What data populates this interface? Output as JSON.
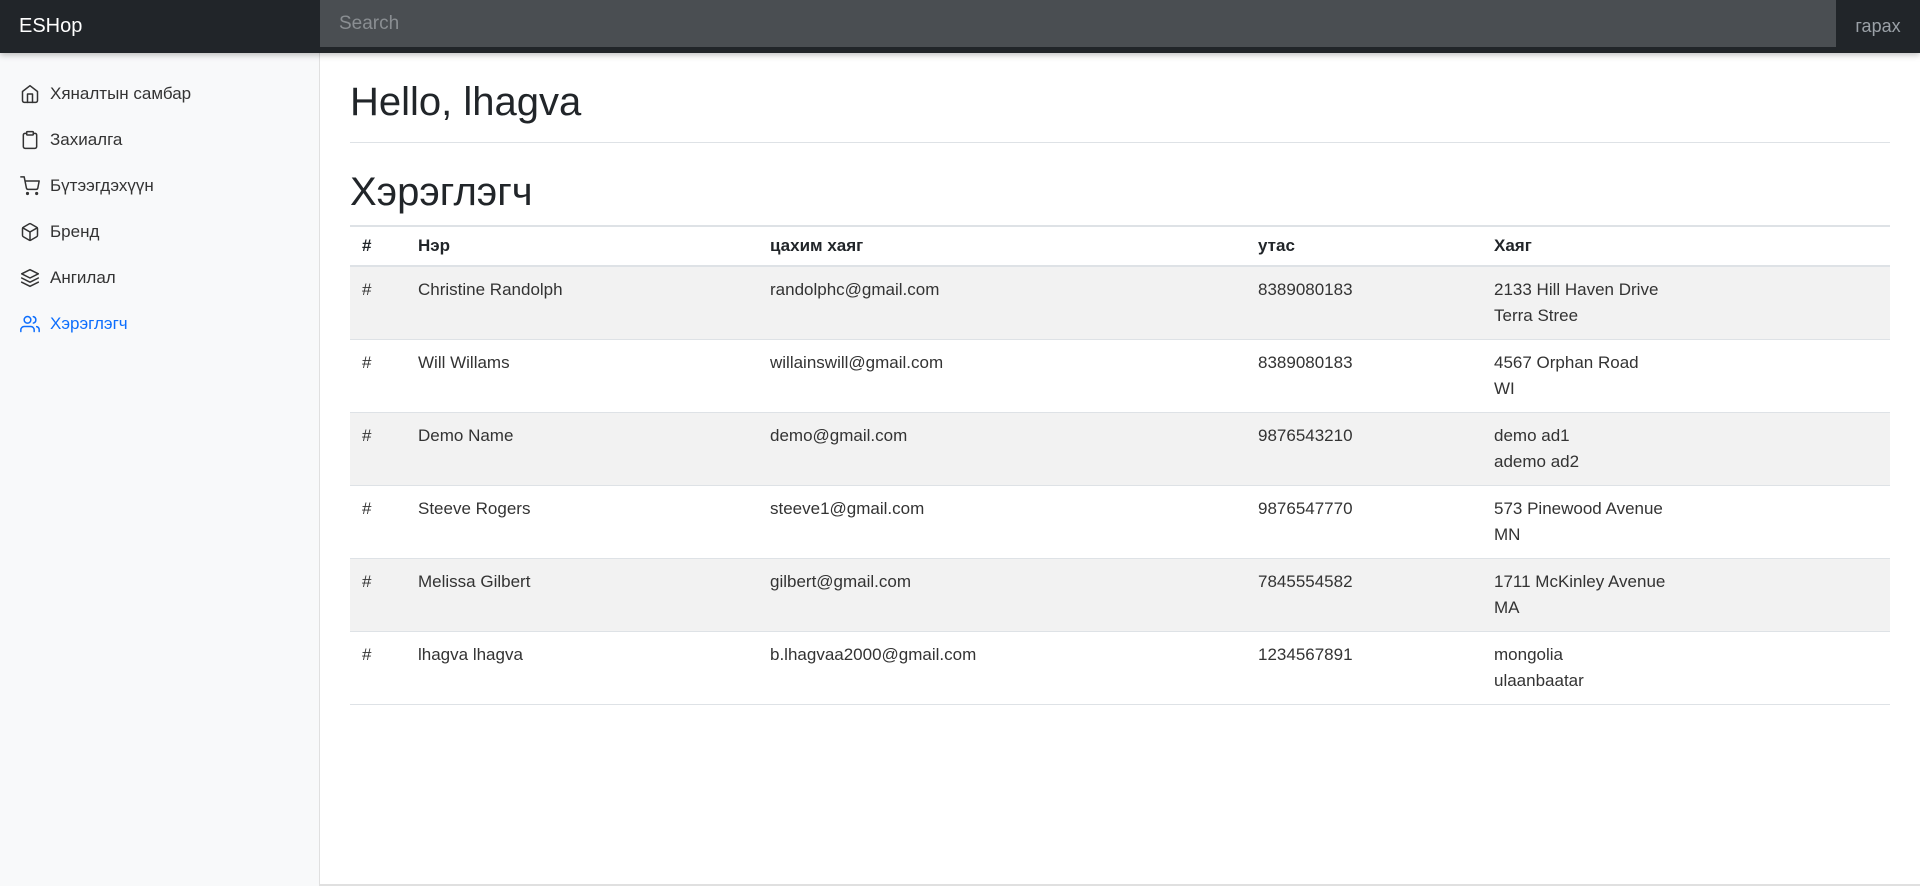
{
  "navbar": {
    "brand": "ESHop",
    "search_placeholder": "Search",
    "signout": "гарах"
  },
  "sidebar": {
    "items": [
      {
        "label": "Хяналтын самбар",
        "icon": "home-icon",
        "active": false
      },
      {
        "label": "Захиалга",
        "icon": "clipboard-icon",
        "active": false
      },
      {
        "label": "Бүтээгдэхүүн",
        "icon": "cart-icon",
        "active": false
      },
      {
        "label": "Бренд",
        "icon": "box-icon",
        "active": false
      },
      {
        "label": "Ангилал",
        "icon": "layers-icon",
        "active": false
      },
      {
        "label": "Хэрэглэгч",
        "icon": "users-icon",
        "active": true
      }
    ]
  },
  "main": {
    "greeting": "Hello, lhagva",
    "section_title": "Хэрэглэгч",
    "table": {
      "headers": [
        "#",
        "Нэр",
        "цахим хаяг",
        "утас",
        "Хаяг"
      ],
      "rows": [
        {
          "num": "#",
          "name": "Christine Randolph",
          "email": "randolphc@gmail.com",
          "phone": "8389080183",
          "address1": "2133 Hill Haven Drive",
          "address2": "Terra Stree"
        },
        {
          "num": "#",
          "name": "Will Willams",
          "email": "willainswill@gmail.com",
          "phone": "8389080183",
          "address1": "4567 Orphan Road",
          "address2": "WI"
        },
        {
          "num": "#",
          "name": "Demo Name",
          "email": "demo@gmail.com",
          "phone": "9876543210",
          "address1": "demo ad1",
          "address2": "ademo ad2"
        },
        {
          "num": "#",
          "name": "Steeve Rogers",
          "email": "steeve1@gmail.com",
          "phone": "9876547770",
          "address1": "573 Pinewood Avenue",
          "address2": "MN"
        },
        {
          "num": "#",
          "name": "Melissa Gilbert",
          "email": "gilbert@gmail.com",
          "phone": "7845554582",
          "address1": "1711 McKinley Avenue",
          "address2": "MA"
        },
        {
          "num": "#",
          "name": "lhagva lhagva",
          "email": "b.lhagvaa2000@gmail.com",
          "phone": "1234567891",
          "address1": "mongolia",
          "address2": "ulaanbaatar"
        }
      ]
    }
  },
  "colors": {
    "navbar_bg": "#212529",
    "search_bg": "#4a4e52",
    "sidebar_bg": "#f8f9fa",
    "active_link": "#0d6efd",
    "striped_row": "#f2f2f2"
  }
}
